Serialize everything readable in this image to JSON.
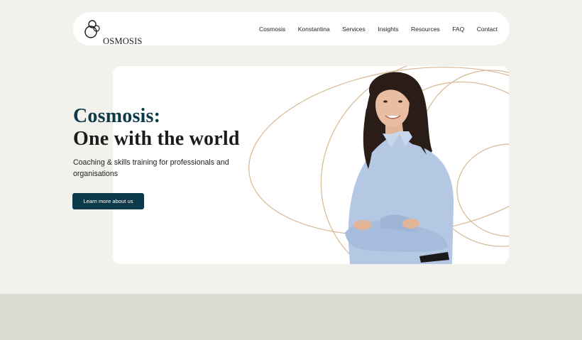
{
  "header": {
    "logo_text": "OSMOSIS",
    "nav": [
      "Cosmosis",
      "Konstantina",
      "Services",
      "Insights",
      "Resources",
      "FAQ",
      "Contact"
    ]
  },
  "hero": {
    "title_line1": "Cosmosis:",
    "title_line2": "One with the world",
    "subtitle": "Coaching & skills training for professionals and organisations",
    "cta_label": "Learn more about us"
  },
  "colors": {
    "page_background": "#f3f1ec",
    "brand_dark_teal": "#0d3a4a",
    "arc_tan": "#d6b894",
    "footer_band": "#dcdcd0"
  },
  "icons": [
    "cosmosis-logo-icon"
  ]
}
